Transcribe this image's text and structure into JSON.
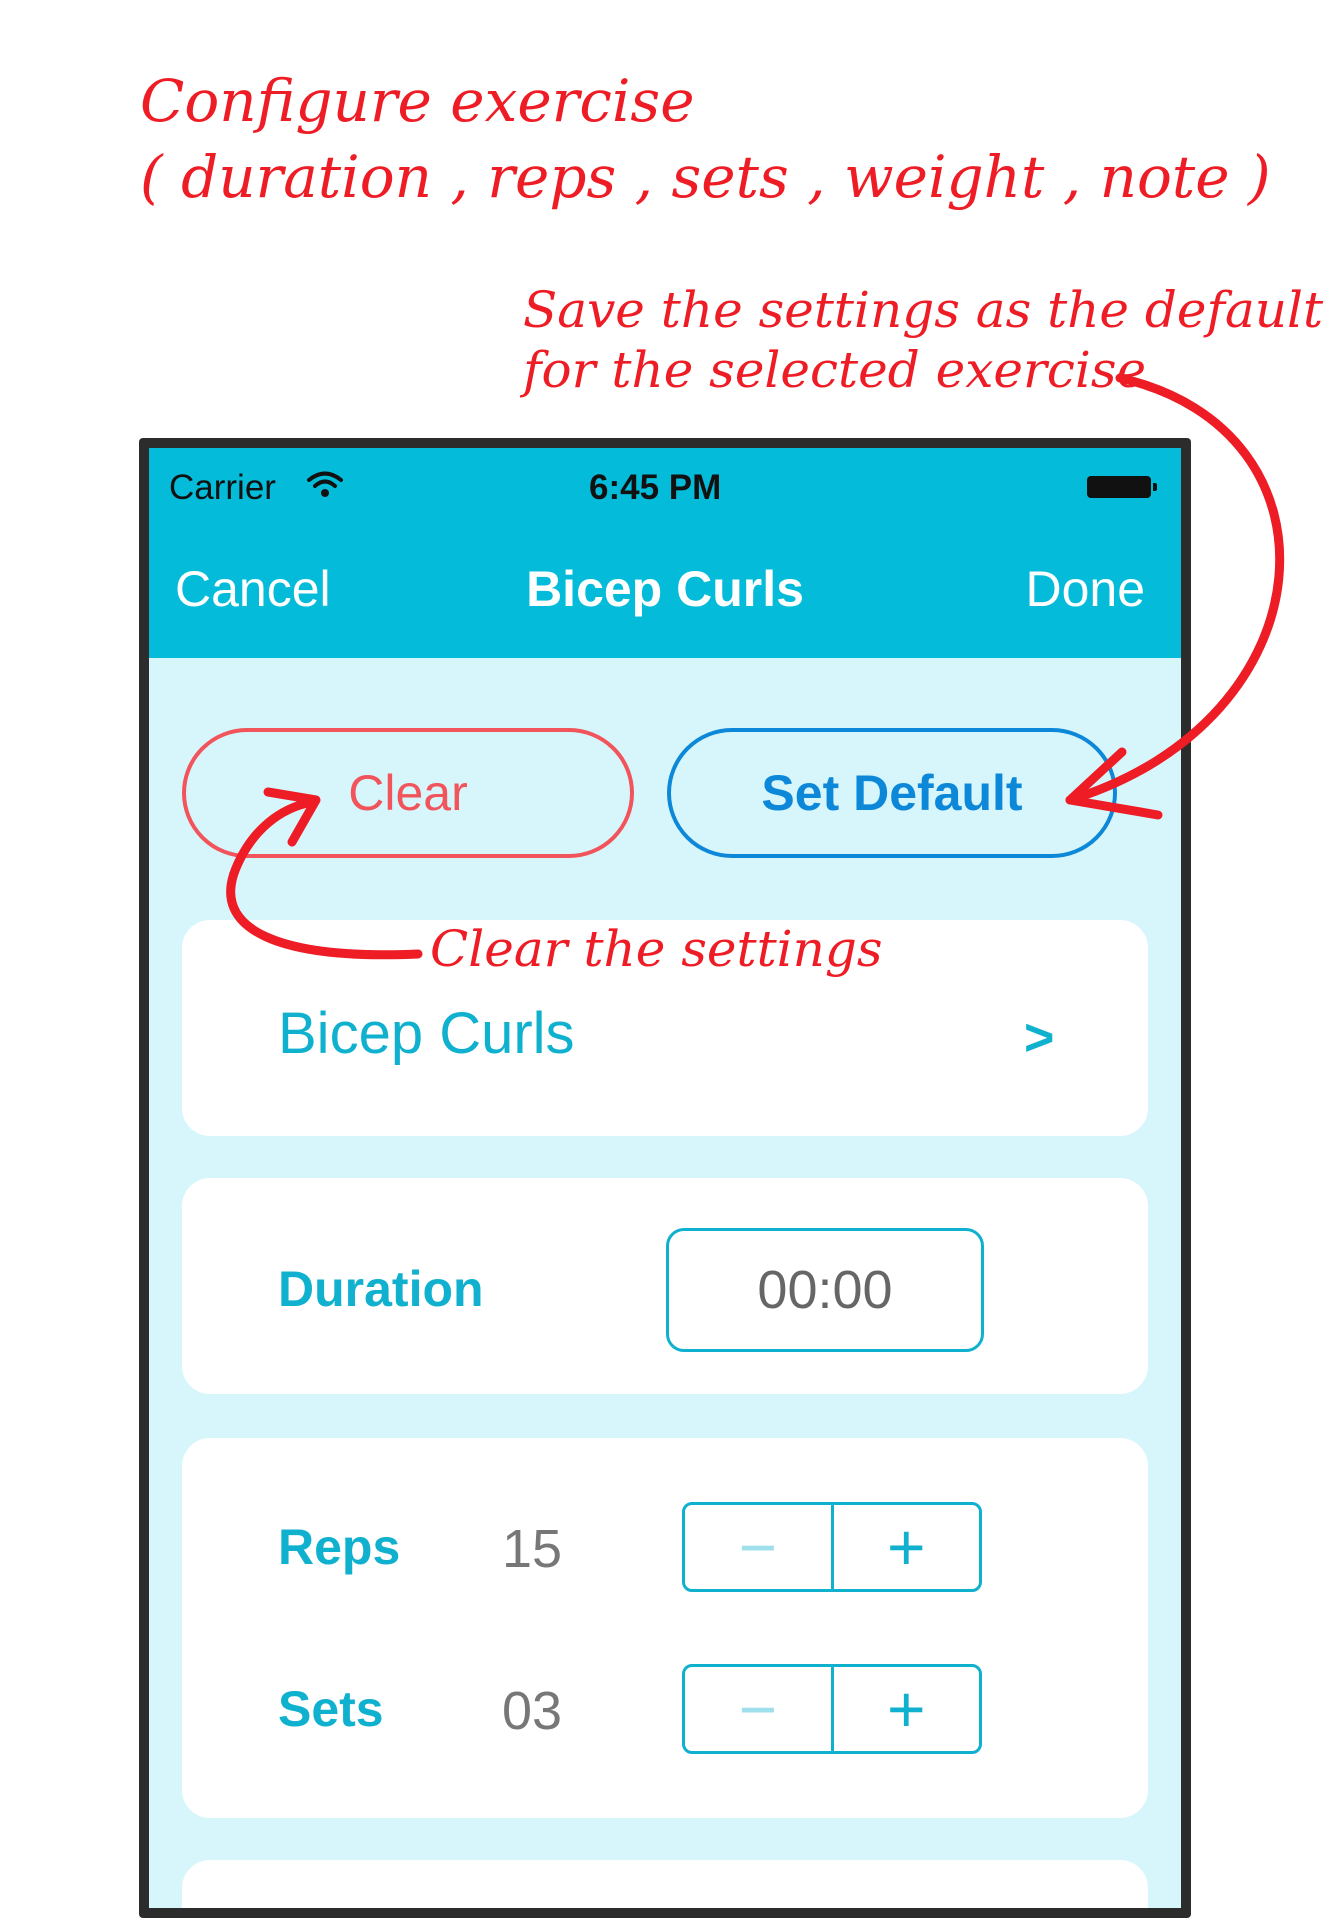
{
  "annotations": {
    "configure_line1": "Configure exercise",
    "configure_line2": "( duration , reps , sets , weight , note )",
    "save_line1": "Save the settings as the default",
    "save_line2": "for the selected exercise",
    "clear": "Clear the settings"
  },
  "status_bar": {
    "carrier": "Carrier",
    "time": "6:45 PM",
    "wifi_icon": "wifi-icon",
    "battery_icon": "battery-icon"
  },
  "nav": {
    "cancel": "Cancel",
    "title": "Bicep Curls",
    "done": "Done"
  },
  "actions": {
    "clear": "Clear",
    "set_default": "Set Default"
  },
  "exercise": {
    "name": "Bicep Curls",
    "chevron": ">"
  },
  "duration": {
    "label": "Duration",
    "value": "00:00"
  },
  "reps": {
    "label": "Reps",
    "value": "15"
  },
  "sets": {
    "label": "Sets",
    "value": "03"
  },
  "stepper": {
    "minus": "−",
    "plus": "+"
  },
  "colors": {
    "nav_bar": "#04bcd9",
    "screen_background": "#d6f6fc",
    "accent": "#0fb1cf",
    "clear_red": "#f2545b",
    "set_default_blue": "#0d88d8",
    "annotation_red": "#ee1c25"
  }
}
